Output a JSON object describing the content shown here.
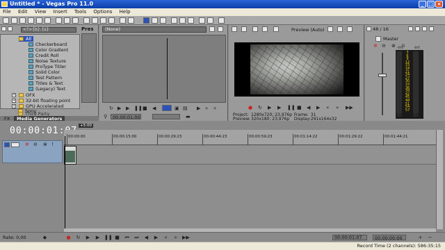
{
  "window": {
    "title": "Untitled * - Vegas Pro 11.0"
  },
  "menu": [
    "File",
    "Edit",
    "View",
    "Insert",
    "Tools",
    "Options",
    "Help"
  ],
  "explorer": {
    "search_value": "<?>{b}.{s}",
    "pres_label": "Pres",
    "tree": [
      {
        "label": "All",
        "type": "folder",
        "selected": true
      },
      {
        "label": "Checkerboard",
        "type": "gen"
      },
      {
        "label": "Color Gradient",
        "type": "gen"
      },
      {
        "label": "Credit Roll",
        "type": "gen"
      },
      {
        "label": "Noise Texture",
        "type": "gen"
      },
      {
        "label": "ProType Titler",
        "type": "gen"
      },
      {
        "label": "Solid Color",
        "type": "gen"
      },
      {
        "label": "Test Pattern",
        "type": "gen"
      },
      {
        "label": "Titles & Text",
        "type": "gen"
      },
      {
        "label": "(Legacy) Text",
        "type": "gen"
      },
      {
        "label": "OFX",
        "type": "folder"
      },
      {
        "label": "32-bit floating point",
        "type": "folder"
      },
      {
        "label": "GPU Accelerated",
        "type": "folder"
      },
      {
        "label": "Sony",
        "type": "folder"
      },
      {
        "label": "Third Party",
        "type": "folder"
      }
    ],
    "tabs": [
      "FX",
      "Media Generators"
    ]
  },
  "trimmer": {
    "select_value": "(None)",
    "timecode": "00:00:01;00"
  },
  "preview": {
    "mode": "Preview (Auto)",
    "project_label": "Project:",
    "project_value": "1280x720; 23,976p",
    "frame_label": "Frame:",
    "frame_value": "31",
    "preview_label": "Preview:",
    "preview_value": "320x180; 23,976p",
    "display_label": "Display:",
    "display_value": "291x164x32"
  },
  "mixer": {
    "count": "48 / 16",
    "master_label": "Master",
    "scale_top": "-Inf.",
    "scale": [
      "3",
      "6",
      "9",
      "12",
      "15",
      "18",
      "21",
      "24",
      "27",
      "30",
      "33",
      "36",
      "39",
      "42",
      "45",
      "48",
      "51",
      "54",
      "57"
    ],
    "values": [
      "0,0",
      "0,0"
    ],
    "left_level": 0.0,
    "right_level": 0.0
  },
  "timeline": {
    "timecode": "00:00:01:07",
    "marker": "+5:00",
    "ruler": [
      "00:00:00",
      "00:00:15:00",
      "00:00:29:23",
      "00:00:44:23",
      "00:00:59:23",
      "00:01:14:22",
      "00:01:29:22",
      "00:01:44:21"
    ]
  },
  "transport": {
    "rate": "Rate: 0,00",
    "timecode": "00:00:01:07",
    "timecode2": "00:00:00:00"
  },
  "status": {
    "text": "Record Time (2 channels): 586:35:15"
  }
}
